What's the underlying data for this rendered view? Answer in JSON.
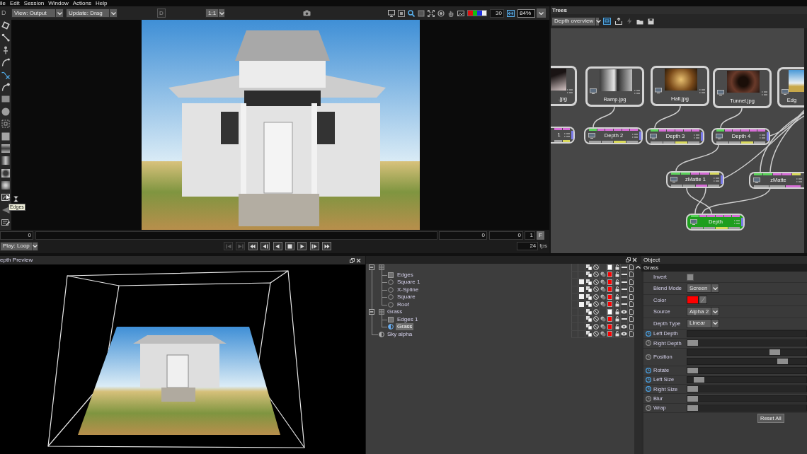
{
  "menu": [
    "ile",
    "Edit",
    "Session",
    "Window",
    "Actions",
    "Help"
  ],
  "viewer": {
    "toolbar": {
      "label": "D",
      "view": "View: Output",
      "update": "Update: Drag",
      "d_button": {
        "label": "D",
        "disabled": true
      },
      "ratio": "1:1",
      "exposure": "30",
      "zoom": "84%"
    },
    "tooltip": "Edges",
    "timeline": {
      "start": "0",
      "frame_a": "0",
      "frame_b": "0",
      "step": "1",
      "f_button": "F"
    },
    "playback": {
      "mode": "Play: Loop",
      "transport_buttons": [
        {
          "disabled": true
        },
        {
          "disabled": true
        },
        {
          "disabled": false
        },
        {
          "disabled": false
        },
        {
          "disabled": false
        },
        {
          "disabled": false
        },
        {
          "disabled": false
        },
        {
          "disabled": false
        },
        {
          "disabled": false
        }
      ],
      "fps": "24",
      "fps_unit": "fps"
    }
  },
  "trees": {
    "title": "Trees",
    "tree_dropdown": "Depth overview",
    "tool_buttons": [
      {
        "disabled": false
      },
      {
        "disabled": false
      },
      {
        "disabled": true
      },
      {
        "disabled": false
      },
      {
        "disabled": false
      }
    ],
    "nodes": [
      {
        "kind": "source",
        "label": ".jpg",
        "selected": false
      },
      {
        "kind": "source",
        "label": "Ramp.jpg",
        "selected": false
      },
      {
        "kind": "source",
        "label": "Hall.jpg",
        "selected": false
      },
      {
        "kind": "source",
        "label": "Tunnel.jpg",
        "selected": false
      },
      {
        "kind": "source",
        "label": "Edg",
        "selected": false
      },
      {
        "kind": "effect",
        "label": "1",
        "selected": false
      },
      {
        "kind": "effect",
        "label": "Depth 2",
        "selected": false
      },
      {
        "kind": "effect",
        "label": "Depth 3",
        "selected": false
      },
      {
        "kind": "effect",
        "label": "Depth 4",
        "selected": false
      },
      {
        "kind": "effect",
        "label": "zMatte 1",
        "selected": false
      },
      {
        "kind": "effect",
        "label": "zMatte",
        "selected": false
      },
      {
        "kind": "effect",
        "label": "Depth",
        "selected": true
      }
    ]
  },
  "depth_preview": {
    "title": "epth Preview"
  },
  "layers": [
    {
      "kind": "group",
      "expanded": true,
      "selected": false,
      "solo": false,
      "color": "#ffffff",
      "visible": false,
      "children": [
        {
          "kind": "layer",
          "label": "Edges",
          "selected": false,
          "solo": false,
          "color": "#ff0000",
          "visible": false
        },
        {
          "kind": "shape",
          "label": "Square 1",
          "selected": false,
          "solo": true,
          "color": "#ff0000",
          "visible": false
        },
        {
          "kind": "shape",
          "label": "X-Spline",
          "selected": false,
          "solo": true,
          "color": "#ff0000",
          "visible": false
        },
        {
          "kind": "shape",
          "label": "Square",
          "selected": false,
          "solo": true,
          "color": "#ff0000",
          "visible": false
        },
        {
          "kind": "shape",
          "label": "Roof",
          "selected": false,
          "solo": true,
          "color": "#ff0000",
          "visible": false
        }
      ]
    },
    {
      "kind": "group",
      "label": "Grass",
      "expanded": true,
      "selected": false,
      "solo": false,
      "color": "#ffffff",
      "visible": true,
      "children": [
        {
          "kind": "layer",
          "label": "Edges 1",
          "selected": false,
          "solo": false,
          "color": "#ff0000",
          "visible": false
        },
        {
          "kind": "alpha",
          "label": "Grass",
          "selected": true,
          "solo": false,
          "color": "#ff0000",
          "visible": true
        }
      ]
    },
    {
      "kind": "alpha",
      "label": "Sky alpha",
      "selected": false,
      "solo": false,
      "color": "#ff0000",
      "visible": true
    }
  ],
  "object": {
    "title": "Object",
    "layer": "Grass",
    "properties": [
      {
        "kind": "checkbox",
        "label": "Invert",
        "checked": false
      },
      {
        "kind": "dropdown",
        "label": "Blend Mode",
        "value": "Screen"
      },
      {
        "kind": "color",
        "label": "Color",
        "color": "#ff0000"
      },
      {
        "kind": "dropdown",
        "label": "Source",
        "value": "Alpha 2"
      },
      {
        "kind": "dropdown",
        "label": "Depth Type",
        "value": "Linear"
      },
      {
        "kind": "slider",
        "label": "Left Depth",
        "animated": true
      },
      {
        "kind": "slider",
        "label": "Right Depth",
        "animated": false,
        "level": 0
      },
      {
        "kind": "vector",
        "label": "Position",
        "animated": false,
        "components": [
          {
            "level": 0.76
          },
          {
            "level": 0.83
          }
        ]
      },
      {
        "kind": "slider",
        "label": "Rotate",
        "animated": true,
        "level": 0
      },
      {
        "kind": "slider",
        "label": "Left Size",
        "animated": true,
        "level": 0.06
      },
      {
        "kind": "slider",
        "label": "Right Size",
        "animated": true,
        "level": 0
      },
      {
        "kind": "slider",
        "label": "Blur",
        "animated": false,
        "level": 0
      },
      {
        "kind": "slider",
        "label": "Wrap",
        "animated": false,
        "level": 0
      }
    ],
    "reset_button": "Reset All"
  }
}
